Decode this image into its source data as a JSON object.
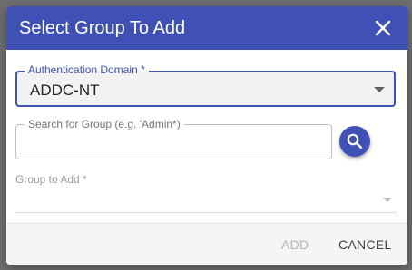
{
  "dialog": {
    "title": "Select Group To Add",
    "close_icon": "close-icon"
  },
  "auth_domain": {
    "label": "Authentication Domain *",
    "value": "ADDC-NT"
  },
  "search": {
    "label": "Search for Group (e.g. 'Admin*)",
    "value": "",
    "icon": "search-icon"
  },
  "group_to_add": {
    "label": "Group to Add *",
    "value": ""
  },
  "footer": {
    "add_label": "ADD",
    "cancel_label": "CANCEL"
  },
  "colors": {
    "primary": "#3f51b5",
    "disabled_text": "#b3b3b3"
  }
}
